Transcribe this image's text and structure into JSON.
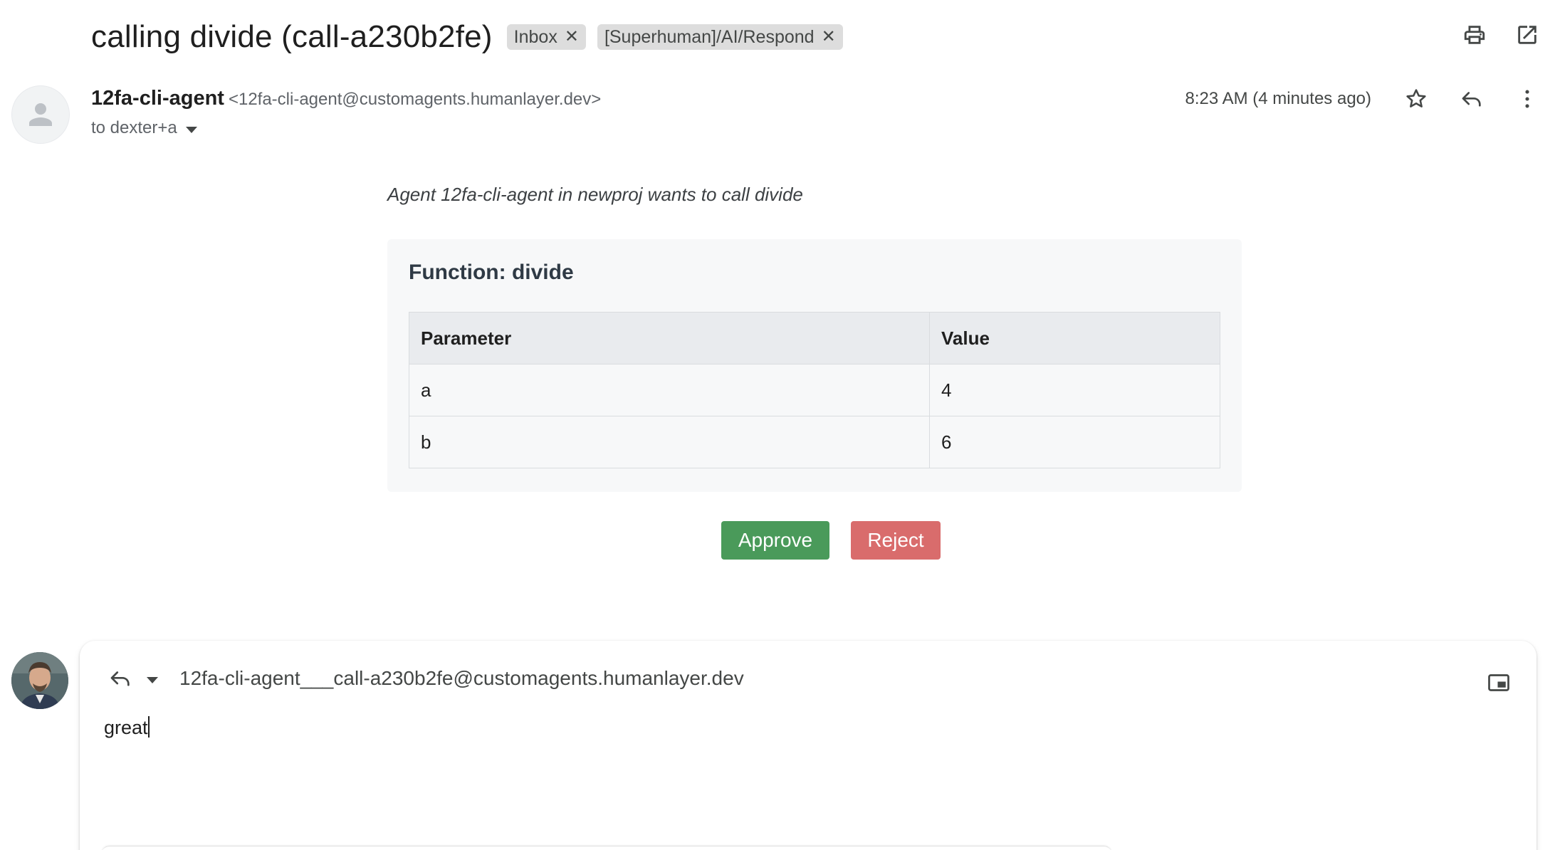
{
  "email": {
    "subject": "calling divide (call-a230b2fe)",
    "labels": [
      {
        "text": "Inbox"
      },
      {
        "text": "[Superhuman]/AI/Respond"
      }
    ],
    "sender_name": "12fa-cli-agent",
    "sender_email": "<12fa-cli-agent@customagents.humanlayer.dev>",
    "to": "to dexter+a",
    "time": "8:23 AM (4 minutes ago)"
  },
  "body": {
    "intro": "Agent 12fa-cli-agent in newproj wants to call divide",
    "function_title": "Function: divide",
    "table": {
      "headers": [
        "Parameter",
        "Value"
      ],
      "rows": [
        [
          "a",
          "4"
        ],
        [
          "b",
          "6"
        ]
      ]
    },
    "approve_label": "Approve",
    "reject_label": "Reject"
  },
  "reply": {
    "to": "12fa-cli-agent___call-a230b2fe@customagents.humanlayer.dev",
    "text": "great"
  },
  "icons": {
    "print": "print-icon",
    "open_new_window": "open-in-new-window-icon",
    "star": "star-icon",
    "reply": "reply-icon",
    "more": "more-vert-icon",
    "popout": "popout-icon",
    "avatar_default": "person-icon"
  },
  "colors": {
    "approve": "#4a9a5a",
    "reject": "#d96c6c",
    "chip_bg": "#dddddd",
    "card_bg": "#f7f8f9"
  }
}
